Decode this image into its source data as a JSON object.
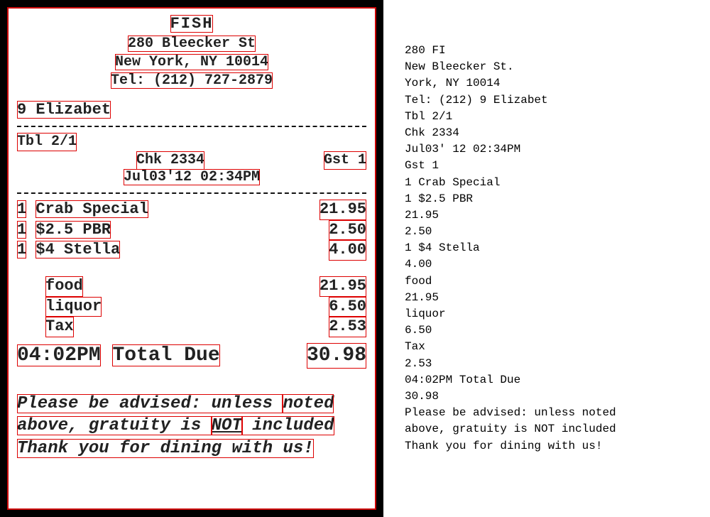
{
  "receipt": {
    "restaurant_name": "FISH",
    "address_line1": "280 Bleecker St",
    "address_line2": "New York, NY 10014",
    "tel": "Tel: (212) 727-2879",
    "server": "9 Elizabet",
    "table": "Tbl 2/1",
    "check": "Chk 2334",
    "guest": "Gst 1",
    "datetime": "Jul03'12 02:34PM",
    "items": [
      {
        "qty": "1",
        "name": "Crab Special",
        "price": "21.95"
      },
      {
        "qty": "1",
        "name": "$2.5 PBR",
        "price": "2.50"
      },
      {
        "qty": "1",
        "name": "$4 Stella",
        "price": "4.00"
      }
    ],
    "subtotals": [
      {
        "label": "food",
        "amount": "21.95"
      },
      {
        "label": "liquor",
        "amount": "6.50"
      },
      {
        "label": "Tax",
        "amount": "2.53"
      }
    ],
    "total_time": "04:02PM",
    "total_label": "Total Due",
    "total_amount": "30.98",
    "footer_line1a": "Please be advised:  unless ",
    "footer_line1b": "noted",
    "footer_line2a": "above, gratuity is ",
    "footer_line2b": "NOT",
    "footer_line2c": " included",
    "footer_line3": "Thank you for dining with us!"
  },
  "ocr": {
    "lines": [
      "280 FI",
      "New Bleecker St.",
      "York, NY 10014",
      "Tel: (212) 9 Elizabet",
      "Tbl 2/1",
      "Chk 2334",
      "Jul03' 12 02:34PM",
      "Gst 1",
      "1 Crab Special",
      "1 $2.5 PBR",
      "21.95",
      "2.50",
      "1 $4 Stella",
      "4.00",
      "food",
      "21.95",
      "liquor",
      "6.50",
      "Tax",
      "2.53",
      "04:02PM Total Due",
      "30.98",
      "Please be advised: unless noted",
      "above, gratuity is NOT included",
      "Thank you for dining with us!"
    ]
  }
}
